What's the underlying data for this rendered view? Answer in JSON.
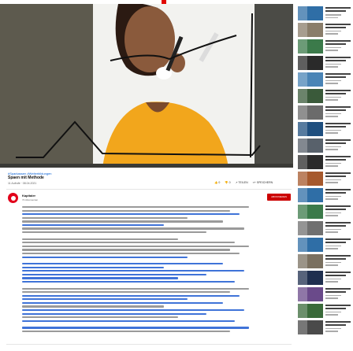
{
  "video": {
    "tags": "#Sparkassen #Weiterbildungen",
    "title": "Spaen mit Methode",
    "meta": "11 Aufrufe · 08.04.2021",
    "actions": {
      "like": "👍 0",
      "dislike": "👎 0",
      "share": "↗ TEILEN",
      "save": "≡+ SPEICHERN"
    }
  },
  "channel": {
    "name": "Kapitaler",
    "subscribers": "72 Abonnenten",
    "subscribe_label": "ABONNIEREN",
    "brand_color": "#e2001a"
  },
  "description_blocks": [
    {
      "lines": [
        "text",
        "text",
        "link",
        "text",
        "text",
        "link",
        "text",
        "text"
      ]
    },
    {
      "lines": [
        "text",
        "text",
        "text",
        "text",
        "text",
        "link"
      ]
    },
    {
      "lines": [
        "link",
        "link",
        "link",
        "link",
        "link",
        "link"
      ]
    },
    {
      "lines": [
        "text",
        "text",
        "link",
        "link",
        "link",
        "text",
        "link",
        "link",
        "text",
        "link"
      ]
    },
    {
      "lines": [
        "link",
        "text"
      ]
    }
  ],
  "sidebar": {
    "thumb_colors": [
      "#2f6ea6",
      "#8a7d6a",
      "#3b7a4a",
      "#2a2a2a",
      "#4a84b6",
      "#3a5a3a",
      "#6b6b6b",
      "#1f4f7f",
      "#58616b",
      "#2b2b2b",
      "#a6592d",
      "#2f6ea6",
      "#3b7a4a",
      "#707070",
      "#2f6ea6",
      "#7a7060",
      "#1f2f4f",
      "#6a4a8a",
      "#3a6a3a",
      "#4a4a4a"
    ]
  }
}
